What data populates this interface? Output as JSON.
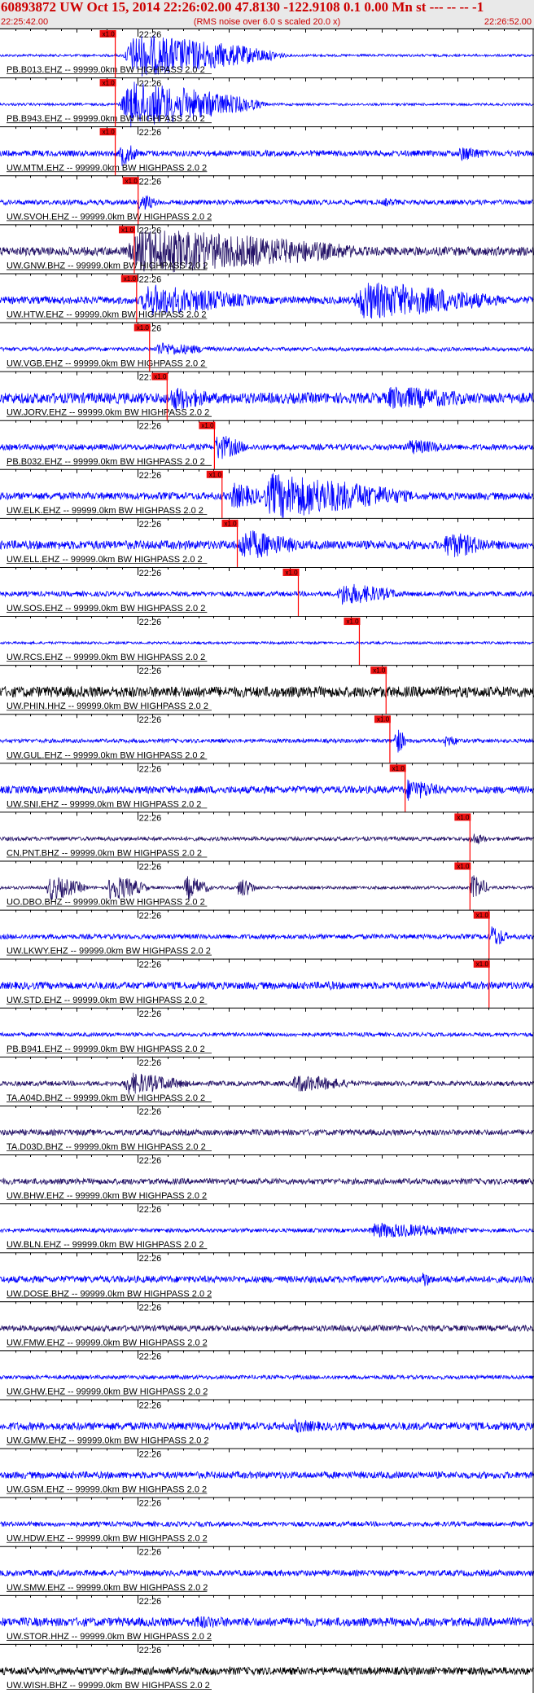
{
  "header": {
    "title": "60893872 UW Oct 15, 2014 22:26:02.00   47.8130 -122.9108  0.1 0.00 Mn st --- -- --  -1",
    "start_time": "22:25:42.00",
    "subtitle": "(RMS noise over 6.0 s scaled 20.0 x)",
    "end_time": "22:26:52.00"
  },
  "colors": {
    "header_text": "#cc0000",
    "header_bg": "#e9e9e9",
    "pick": "#ff0000",
    "pick_box": "#ee1111"
  },
  "chart_data": {
    "type": "line",
    "title": "60893872 UW Oct 15, 2014 22:26:02.00   47.8130 -122.9108  0.1 0.00 Mn st --- -- --  -1",
    "subtitle": "(RMS noise over 6.0 s scaled 20.0 x)",
    "x_axis": {
      "start": "22:25:42.00",
      "end": "22:26:52.00",
      "range_seconds": [
        0,
        70
      ],
      "tick_label": "22:26",
      "tick_seconds": 18
    },
    "pick_label": "x1.0",
    "traces": [
      {
        "label": "PB.B013.EHZ -- 99999.0km BW  HIGHPASS  2.0  2",
        "pick_s": 15.0,
        "color": "#0000ff",
        "noise": 0.05,
        "bursts": [
          {
            "t": 16,
            "d": 22,
            "a": 0.95
          }
        ]
      },
      {
        "label": "PB.B943.EHZ -- 99999.0km BW  HIGHPASS  2.0  2",
        "pick_s": 15.0,
        "color": "#0000ff",
        "noise": 0.05,
        "bursts": [
          {
            "t": 15.5,
            "d": 20,
            "a": 1.0
          }
        ]
      },
      {
        "label": "UW.MTM.EHZ -- 99999.0km BW  HIGHPASS  2.0  2",
        "pick_s": 15.0,
        "color": "#0000ff",
        "noise": 0.12,
        "bursts": [
          {
            "t": 15.5,
            "d": 3,
            "a": 0.6
          },
          {
            "t": 60,
            "d": 5,
            "a": 0.35
          }
        ]
      },
      {
        "label": "UW.SVOH.EHZ -- 99999.0km BW  HIGHPASS  2.0  2",
        "pick_s": 18.0,
        "color": "#0000ff",
        "noise": 0.1,
        "bursts": [
          {
            "t": 18,
            "d": 3,
            "a": 0.45
          },
          {
            "t": 50,
            "d": 4,
            "a": 0.2
          }
        ]
      },
      {
        "label": "UW.GNW.BHZ -- 99999.0km BW  HIGHPASS  2.0  2",
        "pick_s": 17.5,
        "color": "#221066",
        "noise": 0.18,
        "bursts": [
          {
            "t": 16,
            "d": 35,
            "a": 1.0
          }
        ]
      },
      {
        "label": "UW.HTW.EHZ -- 99999.0km BW  HIGHPASS  2.0  2",
        "pick_s": 17.8,
        "color": "#0000ff",
        "noise": 0.15,
        "bursts": [
          {
            "t": 18,
            "d": 18,
            "a": 0.7
          },
          {
            "t": 46,
            "d": 22,
            "a": 0.85
          }
        ]
      },
      {
        "label": "UW.VGB.EHZ -- 99999.0km BW  HIGHPASS  2.0  2",
        "pick_s": 19.5,
        "color": "#0000ff",
        "noise": 0.08,
        "bursts": [
          {
            "t": 20,
            "d": 10,
            "a": 0.3
          }
        ]
      },
      {
        "label": "UW.JORV.EHZ -- 99999.0km BW  HIGHPASS  2.0  2",
        "pick_s": 21.8,
        "color": "#0000ff",
        "noise": 0.22,
        "bursts": [
          {
            "t": 22,
            "d": 8,
            "a": 0.55
          },
          {
            "t": 50,
            "d": 16,
            "a": 0.55
          }
        ]
      },
      {
        "label": "PB.B032.EHZ -- 99999.0km BW  HIGHPASS  2.0  2",
        "pick_s": 28.0,
        "color": "#0000ff",
        "noise": 0.12,
        "bursts": [
          {
            "t": 28,
            "d": 5,
            "a": 0.6
          },
          {
            "t": 53,
            "d": 8,
            "a": 0.35
          }
        ]
      },
      {
        "label": "UW.ELK.EHZ -- 99999.0km BW  HIGHPASS  2.0  2",
        "pick_s": 29.0,
        "color": "#0000ff",
        "noise": 0.15,
        "bursts": [
          {
            "t": 30,
            "d": 6,
            "a": 0.6
          },
          {
            "t": 34,
            "d": 22,
            "a": 1.0
          }
        ]
      },
      {
        "label": "UW.ELL.EHZ -- 99999.0km BW  HIGHPASS  2.0  2",
        "pick_s": 31.0,
        "color": "#0000ff",
        "noise": 0.18,
        "bursts": [
          {
            "t": 31,
            "d": 10,
            "a": 0.7
          },
          {
            "t": 58,
            "d": 8,
            "a": 0.6
          }
        ]
      },
      {
        "label": "UW.SOS.EHZ -- 99999.0km BW  HIGHPASS  2.0  2",
        "pick_s": 39.0,
        "color": "#0000ff",
        "noise": 0.1,
        "bursts": [
          {
            "t": 44,
            "d": 10,
            "a": 0.5
          }
        ]
      },
      {
        "label": "UW.RCS.EHZ -- 99999.0km BW  HIGHPASS  2.0  2",
        "pick_s": 47.0,
        "color": "#0000ff",
        "noise": 0.05,
        "bursts": []
      },
      {
        "label": "UW.PHIN.HHZ -- 99999.0km BW  HIGHPASS  2.0  2",
        "pick_s": 50.5,
        "color": "#000000",
        "noise": 0.22,
        "bursts": [
          {
            "t": 60,
            "d": 8,
            "a": 0.25
          }
        ]
      },
      {
        "label": "UW.GUL.EHZ -- 99999.0km BW  HIGHPASS  2.0  2",
        "pick_s": 51.0,
        "color": "#0000ff",
        "noise": 0.08,
        "bursts": [
          {
            "t": 51.5,
            "d": 2,
            "a": 0.7
          },
          {
            "t": 58,
            "d": 3,
            "a": 0.3
          }
        ]
      },
      {
        "label": "UW.SNI.EHZ -- 99999.0km BW  HIGHPASS  2.0  2",
        "pick_s": 53.0,
        "color": "#0000ff",
        "noise": 0.15,
        "bursts": [
          {
            "t": 53,
            "d": 6,
            "a": 0.5
          }
        ]
      },
      {
        "label": "CN.PNT.BHZ -- 99999.0km BW  HIGHPASS  2.0  2",
        "pick_s": 61.5,
        "color": "#221066",
        "noise": 0.08,
        "bursts": [
          {
            "t": 61.5,
            "d": 3,
            "a": 0.3
          }
        ]
      },
      {
        "label": "UO.DBO.BHZ -- 99999.0km BW  HIGHPASS  2.0  2",
        "pick_s": 61.5,
        "color": "#221066",
        "noise": 0.06,
        "bursts": [
          {
            "t": 6,
            "d": 6,
            "a": 0.55
          },
          {
            "t": 14,
            "d": 6,
            "a": 0.6
          },
          {
            "t": 24,
            "d": 4,
            "a": 0.55
          },
          {
            "t": 31,
            "d": 3,
            "a": 0.5
          },
          {
            "t": 61.5,
            "d": 3,
            "a": 0.6
          }
        ]
      },
      {
        "label": "UW.LKWY.EHZ -- 99999.0km BW  HIGHPASS  2.0  2",
        "pick_s": 64.0,
        "color": "#0000ff",
        "noise": 0.1,
        "bursts": [
          {
            "t": 64,
            "d": 3,
            "a": 0.55
          }
        ]
      },
      {
        "label": "UW.STD.EHZ -- 99999.0km BW  HIGHPASS  2.0  2",
        "pick_s": 64.0,
        "color": "#0000ff",
        "noise": 0.15,
        "bursts": [
          {
            "t": 42,
            "d": 8,
            "a": 0.2
          }
        ]
      },
      {
        "label": "PB.B941.EHZ -- 99999.0km BW  HIGHPASS  2.0  2",
        "pick_s": null,
        "color": "#0000ff",
        "noise": 0.08,
        "bursts": []
      },
      {
        "label": "TA.A04D.BHZ -- 99999.0km BW  HIGHPASS  2.0  2",
        "pick_s": null,
        "color": "#221066",
        "noise": 0.1,
        "bursts": [
          {
            "t": 16,
            "d": 10,
            "a": 0.5
          },
          {
            "t": 38,
            "d": 10,
            "a": 0.4
          }
        ]
      },
      {
        "label": "TA.D03D.BHZ -- 99999.0km BW  HIGHPASS  2.0  2",
        "pick_s": null,
        "color": "#221066",
        "noise": 0.12,
        "bursts": []
      },
      {
        "label": "UW.BHW.EHZ -- 99999.0km BW  HIGHPASS  2.0  2",
        "pick_s": null,
        "color": "#221066",
        "noise": 0.12,
        "bursts": []
      },
      {
        "label": "UW.BLN.EHZ -- 99999.0km BW  HIGHPASS  2.0  2",
        "pick_s": null,
        "color": "#0000ff",
        "noise": 0.08,
        "bursts": [
          {
            "t": 48,
            "d": 16,
            "a": 0.35
          }
        ]
      },
      {
        "label": "UW.DOSE.BHZ -- 99999.0km BW  HIGHPASS  2.0  2",
        "pick_s": null,
        "color": "#0000ff",
        "noise": 0.14,
        "bursts": [
          {
            "t": 55,
            "d": 2,
            "a": 0.45
          }
        ]
      },
      {
        "label": "UW.FMW.EHZ -- 99999.0km BW  HIGHPASS  2.0  2",
        "pick_s": null,
        "color": "#221066",
        "noise": 0.12,
        "bursts": []
      },
      {
        "label": "UW.GHW.EHZ -- 99999.0km BW  HIGHPASS  2.0  2",
        "pick_s": null,
        "color": "#0000ff",
        "noise": 0.08,
        "bursts": []
      },
      {
        "label": "UW.GMW.EHZ -- 99999.0km BW  HIGHPASS  2.0  2",
        "pick_s": null,
        "color": "#0000ff",
        "noise": 0.16,
        "bursts": [
          {
            "t": 38,
            "d": 8,
            "a": 0.3
          }
        ]
      },
      {
        "label": "UW.GSM.EHZ -- 99999.0km BW  HIGHPASS  2.0  2",
        "pick_s": null,
        "color": "#0000ff",
        "noise": 0.14,
        "bursts": []
      },
      {
        "label": "UW.HDW.EHZ -- 99999.0km BW  HIGHPASS  2.0  2",
        "pick_s": null,
        "color": "#0000ff",
        "noise": 0.1,
        "bursts": []
      },
      {
        "label": "UW.SMW.EHZ -- 99999.0km BW  HIGHPASS  2.0  2",
        "pick_s": null,
        "color": "#0000ff",
        "noise": 0.12,
        "bursts": []
      },
      {
        "label": "UW.STOR.HHZ -- 99999.0km BW  HIGHPASS  2.0  2",
        "pick_s": null,
        "color": "#0000ff",
        "noise": 0.18,
        "bursts": [
          {
            "t": 25,
            "d": 10,
            "a": 0.3
          }
        ]
      },
      {
        "label": "UW.WISH.BHZ -- 99999.0km BW  HIGHPASS  2.0  2",
        "pick_s": null,
        "color": "#000000",
        "noise": 0.16,
        "bursts": []
      }
    ]
  }
}
